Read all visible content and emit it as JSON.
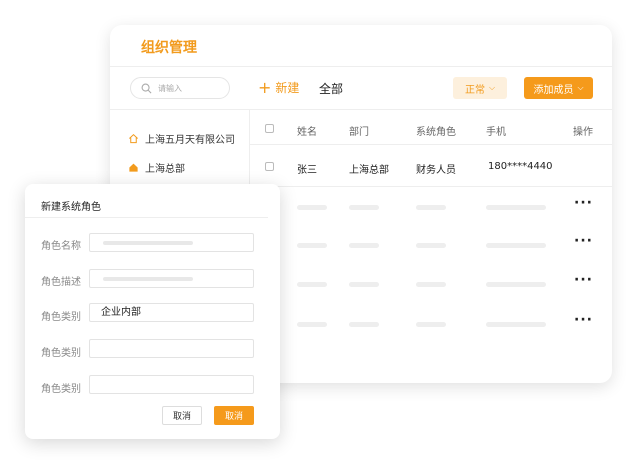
{
  "colors": {
    "accent": "#f29b1d",
    "accent_bg": "#fdf0dd",
    "button": "#f59a1b"
  },
  "header": {
    "title": "组织管理"
  },
  "toolbar": {
    "search_placeholder": "请输入",
    "new_label": "新建",
    "all_label": "全部",
    "status_label": "正常",
    "add_member_label": "添加成员"
  },
  "tree": {
    "company": "上海五月天有限公司",
    "branch": "上海总部"
  },
  "table": {
    "columns": [
      "姓名",
      "部门",
      "系统角色",
      "手机",
      "操作"
    ],
    "rows": [
      {
        "name": "张三",
        "dept": "上海总部",
        "role": "财务人员",
        "phone": "180****4440"
      }
    ],
    "more_label": "···"
  },
  "modal": {
    "title": "新建系统角色",
    "fields": [
      {
        "label": "角色名称",
        "value": ""
      },
      {
        "label": "角色描述",
        "value": ""
      },
      {
        "label": "角色类别",
        "value": "企业内部"
      },
      {
        "label": "角色类别",
        "value": ""
      },
      {
        "label": "角色类别",
        "value": ""
      }
    ],
    "cancel_label": "取消",
    "confirm_label": "取消"
  }
}
